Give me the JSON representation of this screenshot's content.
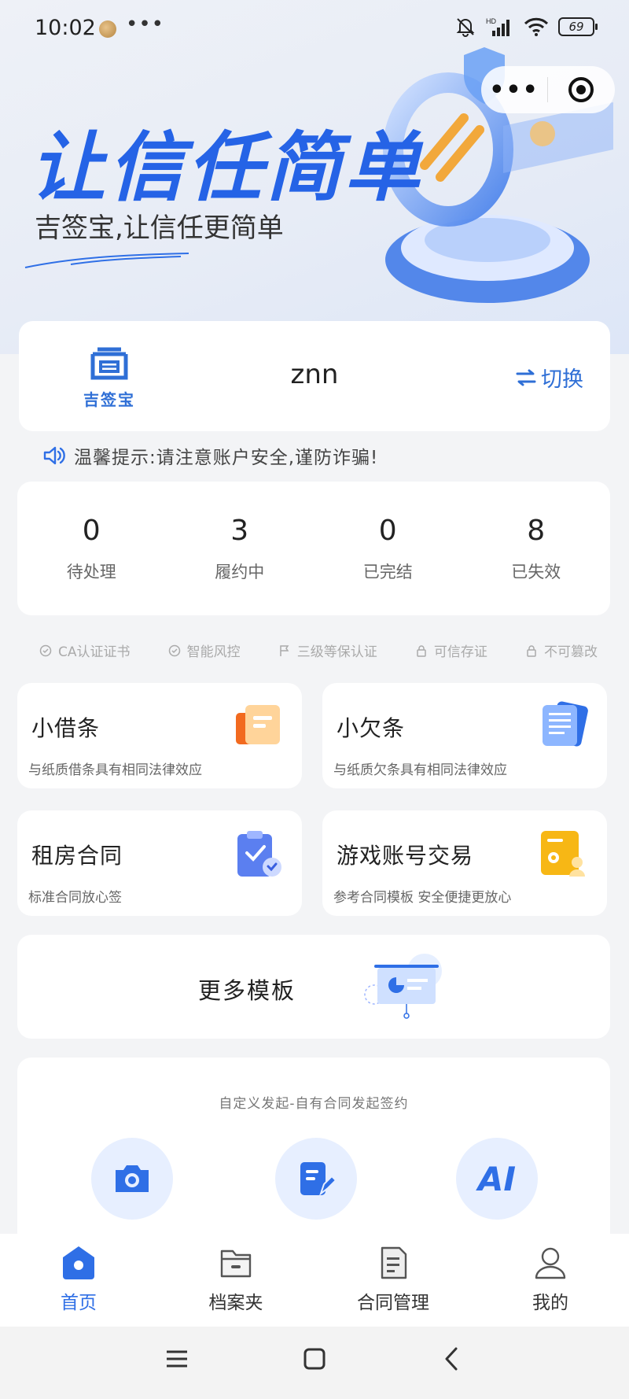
{
  "status_bar": {
    "time": "10:02",
    "more": "•••",
    "battery": "69"
  },
  "capsule": {
    "more": "•••"
  },
  "hero": {
    "title": "让信任简单",
    "subtitle": "吉签宝,让信任更简单"
  },
  "user_card": {
    "logo_text": "吉签宝",
    "username": "znn",
    "switch_label": "切换"
  },
  "notice": "温馨提示:请注意账户安全,谨防诈骗!",
  "stats": [
    {
      "value": "0",
      "label": "待处理"
    },
    {
      "value": "3",
      "label": "履约中"
    },
    {
      "value": "0",
      "label": "已完结"
    },
    {
      "value": "8",
      "label": "已失效"
    }
  ],
  "features": [
    "CA认证证书",
    "智能风控",
    "三级等保认证",
    "可信存证",
    "不可篡改"
  ],
  "templates": [
    {
      "title": "小借条",
      "desc": "与纸质借条具有相同法律效应"
    },
    {
      "title": "小欠条",
      "desc": "与纸质欠条具有相同法律效应"
    },
    {
      "title": "租房合同",
      "desc": "标准合同放心签"
    },
    {
      "title": "游戏账号交易",
      "desc": "参考合同模板 安全便捷更放心"
    }
  ],
  "more_templates": "更多模板",
  "custom": {
    "title": "自定义发起-自有合同发起签约",
    "ai_label": "AI"
  },
  "tabs": [
    {
      "label": "首页",
      "active": true
    },
    {
      "label": "档案夹",
      "active": false
    },
    {
      "label": "合同管理",
      "active": false
    },
    {
      "label": "我的",
      "active": false
    }
  ],
  "colors": {
    "accent": "#2f6fe6",
    "background": "#f3f4f6",
    "card": "#ffffff"
  }
}
